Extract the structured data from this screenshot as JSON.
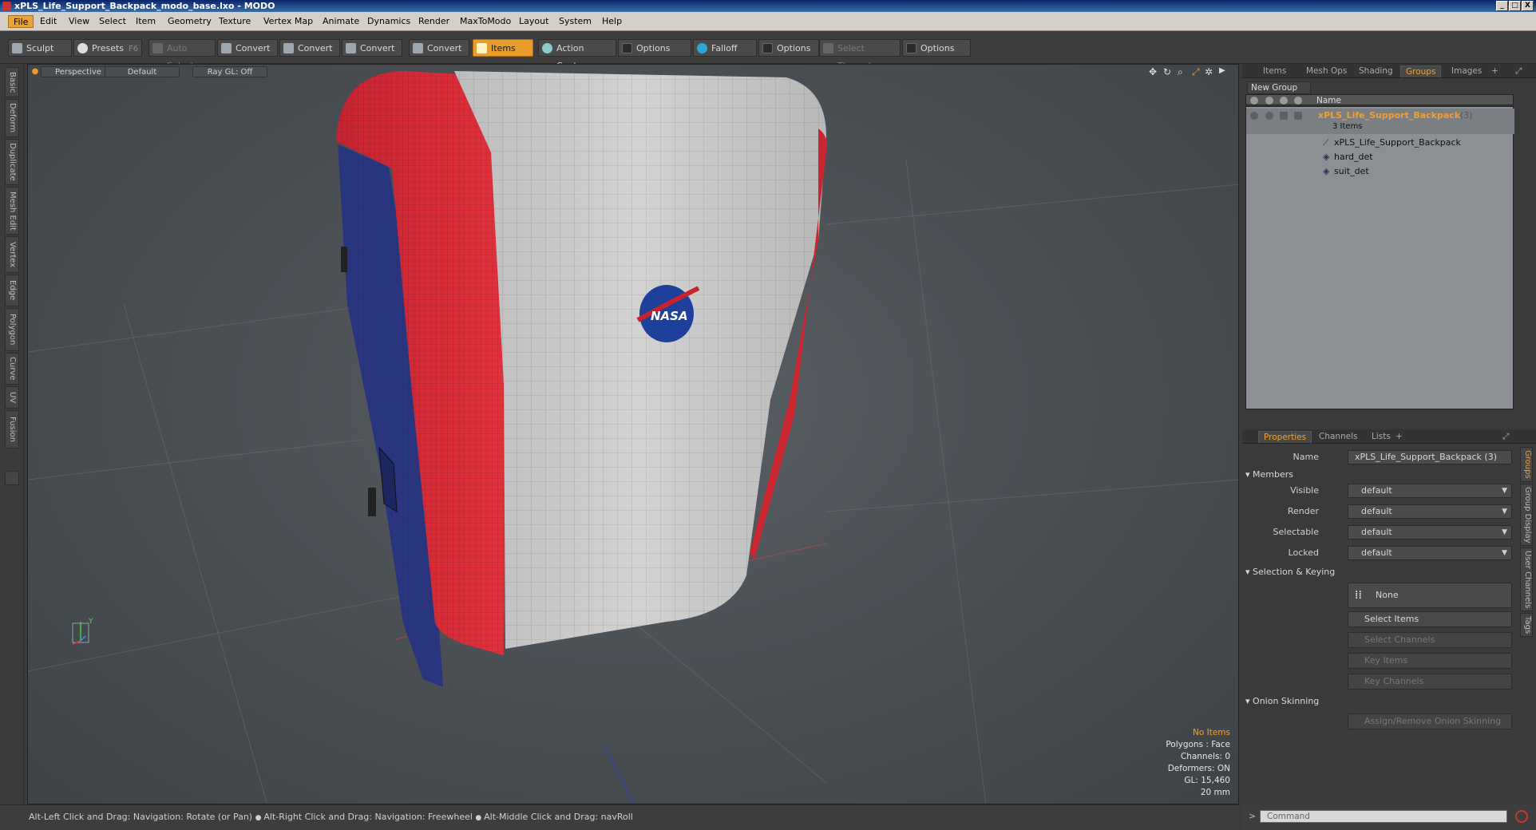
{
  "window": {
    "title": "xPLS_Life_Support_Backpack_modo_base.lxo - MODO",
    "buttons": [
      "_",
      "□",
      "X"
    ]
  },
  "menu": [
    "File",
    "Edit",
    "View",
    "Select",
    "Item",
    "Geometry",
    "Texture",
    "Vertex Map",
    "Animate",
    "Dynamics",
    "Render",
    "MaxToModo",
    "Layout",
    "System",
    "Help"
  ],
  "toolbar": {
    "sculpt": "Sculpt",
    "presets": "Presets",
    "presets_shortcut": "F6",
    "auto_select": "Auto Select",
    "convert1": "Convert",
    "convert2": "Convert",
    "convert3": "Convert",
    "convert4": "Convert",
    "items": "Items",
    "action_center": "Action Center",
    "options1": "Options",
    "falloff": "Falloff",
    "options2": "Options",
    "select_through": "Select Through",
    "options3": "Options"
  },
  "left_tabs": [
    "Basic",
    "Deform",
    "Duplicate",
    "Mesh Edit",
    "Vertex",
    "Edge",
    "Polygon",
    "Curve",
    "UV",
    "Fusion"
  ],
  "viewport": {
    "view": "Perspective",
    "shading": "Default",
    "raygl": "Ray GL: Off",
    "logo_text": "NASA",
    "info": {
      "selection": "No Items",
      "polygons": "Polygons : Face",
      "channels": "Channels: 0",
      "deformers": "Deformers: ON",
      "gl": "GL: 15,460",
      "scale": "20 mm"
    },
    "axis_label": "Y"
  },
  "top_panel": {
    "tabs": [
      "Items",
      "Mesh Ops",
      "Shading",
      "Groups",
      "Images"
    ],
    "active_tab": "Groups",
    "new_group": "New Group",
    "column_name": "Name",
    "group": {
      "name": "xPLS_Life_Support_Backpack",
      "count": "(3)",
      "subtitle": "3 Items",
      "children": [
        "xPLS_Life_Support_Backpack",
        "hard_det",
        "suit_det"
      ]
    }
  },
  "props_panel": {
    "tabs": [
      "Properties",
      "Channels",
      "Lists"
    ],
    "active_tab": "Properties",
    "name_label": "Name",
    "name_value": "xPLS_Life_Support_Backpack (3)",
    "members_section": "Members",
    "fields": [
      {
        "label": "Visible",
        "value": "default"
      },
      {
        "label": "Render",
        "value": "default"
      },
      {
        "label": "Selectable",
        "value": "default"
      },
      {
        "label": "Locked",
        "value": "default"
      }
    ],
    "selection_section": "Selection & Keying",
    "none_label": "None",
    "select_items": "Select Items",
    "select_channels": "Select Channels",
    "key_items": "Key Items",
    "key_channels": "Key Channels",
    "onion_section": "Onion Skinning",
    "onion_button": "Assign/Remove Onion Skinning",
    "side_tabs": [
      "Groups",
      "Group Display",
      "User Channels",
      "Tags"
    ]
  },
  "status": {
    "hint1": "Alt-Left Click and Drag: Navigation: Rotate (or Pan)",
    "hint2": "Alt-Right Click and Drag: Navigation: Freewheel",
    "hint3": "Alt-Middle Click and Drag: navRoll",
    "command_placeholder": "Command"
  },
  "colors": {
    "accent": "#e89c2c",
    "backpack_red": "#d42a35",
    "backpack_blue": "#2a3580",
    "backpack_white": "#c9c9c9"
  }
}
